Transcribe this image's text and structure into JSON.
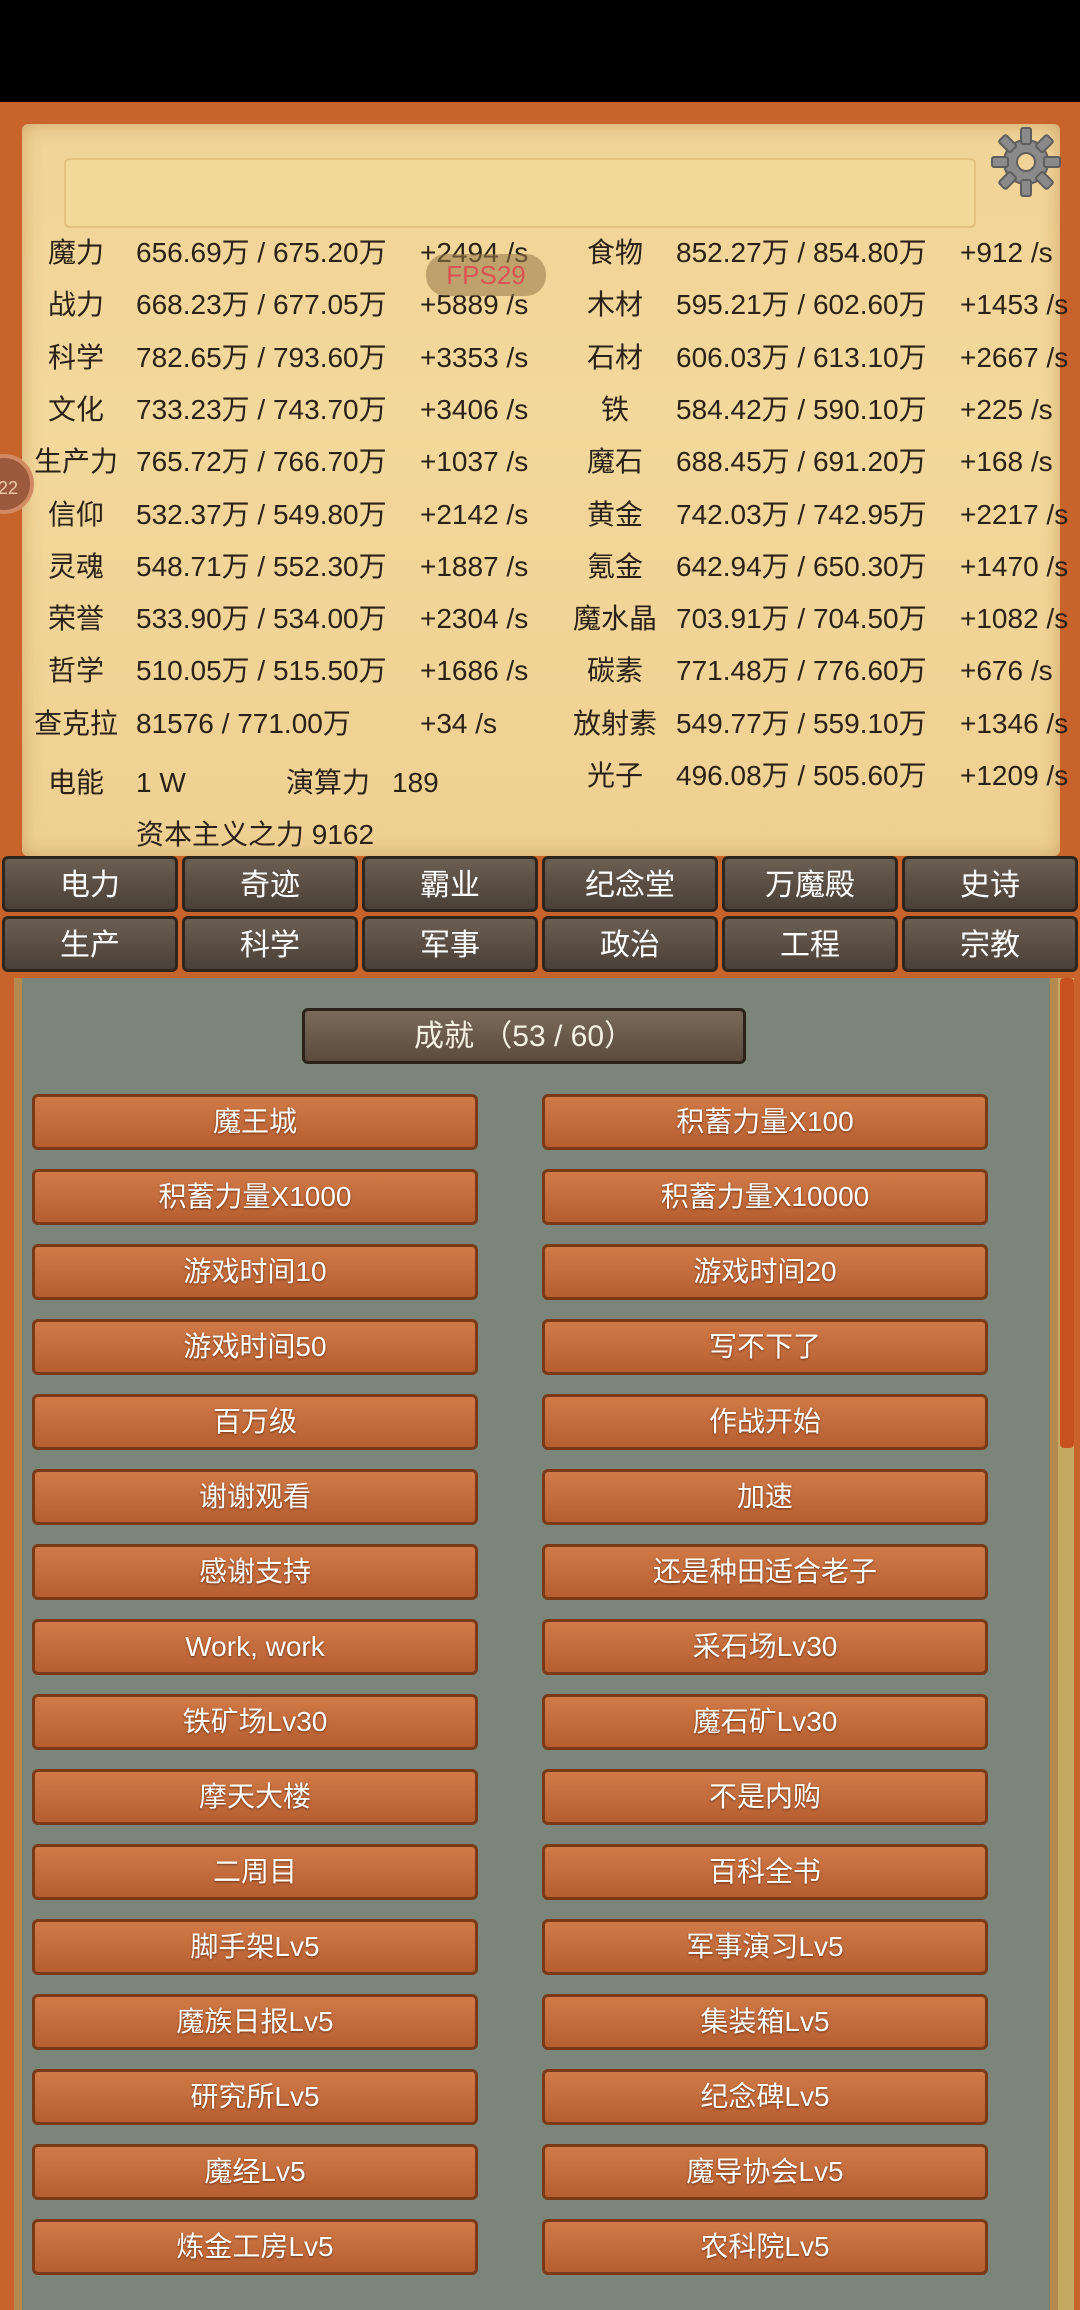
{
  "fps": "FPS29",
  "left_badge": "22",
  "resources_left": [
    {
      "name": "魔力",
      "value": "656.69万 / 675.20万",
      "rate": "+2494 /s"
    },
    {
      "name": "战力",
      "value": "668.23万 / 677.05万",
      "rate": "+5889 /s"
    },
    {
      "name": "科学",
      "value": "782.65万 / 793.60万",
      "rate": "+3353 /s"
    },
    {
      "name": "文化",
      "value": "733.23万 / 743.70万",
      "rate": "+3406 /s"
    },
    {
      "name": "生产力",
      "value": "765.72万 / 766.70万",
      "rate": "+1037 /s"
    },
    {
      "name": "信仰",
      "value": "532.37万 / 549.80万",
      "rate": "+2142 /s"
    },
    {
      "name": "灵魂",
      "value": "548.71万 / 552.30万",
      "rate": "+1887 /s"
    },
    {
      "name": "荣誉",
      "value": "533.90万 / 534.00万",
      "rate": "+2304 /s"
    },
    {
      "name": "哲学",
      "value": "510.05万 / 515.50万",
      "rate": "+1686 /s"
    },
    {
      "name": "查克拉",
      "value": "81576 / 771.00万",
      "rate": "+34 /s"
    }
  ],
  "resources_right": [
    {
      "name": "食物",
      "value": "852.27万 / 854.80万",
      "rate": "+912 /s"
    },
    {
      "name": "木材",
      "value": "595.21万 / 602.60万",
      "rate": "+1453 /s"
    },
    {
      "name": "石材",
      "value": "606.03万 / 613.10万",
      "rate": "+2667 /s"
    },
    {
      "name": "铁",
      "value": "584.42万 / 590.10万",
      "rate": "+225 /s"
    },
    {
      "name": "魔石",
      "value": "688.45万 / 691.20万",
      "rate": "+168 /s"
    },
    {
      "name": "黄金",
      "value": "742.03万 / 742.95万",
      "rate": "+2217 /s"
    },
    {
      "name": "氪金",
      "value": "642.94万 / 650.30万",
      "rate": "+1470 /s"
    },
    {
      "name": "魔水晶",
      "value": "703.91万 / 704.50万",
      "rate": "+1082 /s"
    },
    {
      "name": "碳素",
      "value": "771.48万 / 776.60万",
      "rate": "+676 /s"
    },
    {
      "name": "放射素",
      "value": "549.77万 / 559.10万",
      "rate": "+1346 /s"
    },
    {
      "name": "光子",
      "value": "496.08万 / 505.60万",
      "rate": "+1209 /s"
    }
  ],
  "power": {
    "label": "电能",
    "value": "1 W",
    "compute_label": "演算力",
    "compute_value": "189"
  },
  "capitalism": "资本主义之力 9162",
  "tabs_row1": [
    "电力",
    "奇迹",
    "霸业",
    "纪念堂",
    "万魔殿",
    "史诗"
  ],
  "tabs_row2": [
    "生产",
    "科学",
    "军事",
    "政治",
    "工程",
    "宗教"
  ],
  "achievements_title": "成就 （53 / 60）",
  "achievements": [
    "魔王城",
    "积蓄力量X100",
    "积蓄力量X1000",
    "积蓄力量X10000",
    "游戏时间10",
    "游戏时间20",
    "游戏时间50",
    "写不下了",
    "百万级",
    "作战开始",
    "谢谢观看",
    "加速",
    "感谢支持",
    "还是种田适合老子",
    "Work, work",
    "采石场Lv30",
    "铁矿场Lv30",
    "魔石矿Lv30",
    "摩天大楼",
    "不是内购",
    "二周目",
    "百科全书",
    "脚手架Lv5",
    "军事演习Lv5",
    "魔族日报Lv5",
    "集装箱Lv5",
    "研究所Lv5",
    "纪念碑Lv5",
    "魔经Lv5",
    "魔导协会Lv5",
    "炼金工房Lv5",
    "农科院Lv5"
  ]
}
